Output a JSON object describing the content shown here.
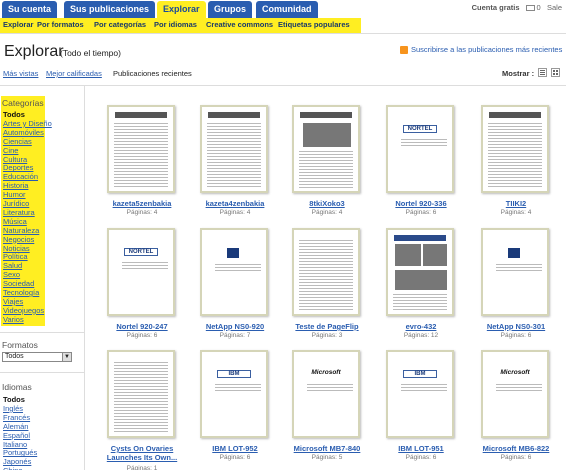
{
  "nav": {
    "tabs": [
      "Su cuenta",
      "Sus publicaciones",
      "Explorar",
      "Grupos",
      "Comunidad"
    ],
    "account": "Cuenta gratis",
    "mail_count": "0",
    "logout": "Sale"
  },
  "subnav": [
    "Explorar",
    "Por formatos",
    "Por categorías",
    "Por idiomas",
    "Creative commons",
    "Etiquetas populares"
  ],
  "header": {
    "title": "Explorar",
    "subtitle": "(Todo el tiempo)",
    "subscribe": "Suscribirse a las publicaciones más recientes"
  },
  "views": {
    "most_viewed": "Más vistas",
    "best_rated": "Mejor calificadas",
    "recent": "Publicaciones recientes",
    "show": "Mostrar :"
  },
  "sidebar": {
    "categories_heading": "Categorías",
    "categories": [
      "Todos",
      "Artes y Diseño",
      "Automóviles",
      "Ciencias",
      "Cine",
      "Cultura",
      "Deportes",
      "Educación",
      "Historia",
      "Humor",
      "Jurídico",
      "Literatura",
      "Música",
      "Naturaleza",
      "Negocios",
      "Noticias",
      "Política",
      "Salud",
      "Sexo",
      "Sociedad",
      "Tecnología",
      "Viajes",
      "Videojuegos",
      "Varios"
    ],
    "formats_heading": "Formatos",
    "format_selected": "Todos",
    "languages_heading": "Idiomas",
    "languages": [
      "Todos",
      "Inglés",
      "Francés",
      "Alemán",
      "Español",
      "Italiano",
      "Portugués",
      "Japonés",
      "Chino"
    ]
  },
  "docs": [
    {
      "title": "kazeta5zenbakia",
      "pages": "Páginas: 4",
      "style": "news"
    },
    {
      "title": "kazeta4zenbakia",
      "pages": "Páginas: 4",
      "style": "news"
    },
    {
      "title": "8tkiXoko3",
      "pages": "Páginas: 4",
      "style": "news2"
    },
    {
      "title": "Nortel 920-336",
      "pages": "Páginas: 6",
      "style": "nortel"
    },
    {
      "title": "TIIKI2",
      "pages": "Páginas: 4",
      "style": "news"
    },
    {
      "title": "Nortel 920-247",
      "pages": "Páginas: 6",
      "style": "nortel"
    },
    {
      "title": "NetApp NS0-920",
      "pages": "Páginas: 7",
      "style": "netapp"
    },
    {
      "title": "Teste de PageFlip",
      "pages": "Páginas: 3",
      "style": "plain"
    },
    {
      "title": "evro-432",
      "pages": "Páginas: 12",
      "style": "magazine"
    },
    {
      "title": "NetApp NS0-301",
      "pages": "Páginas: 6",
      "style": "netapp"
    },
    {
      "title": "Cysts On Ovaries Launches Its Own...",
      "pages": "Páginas: 1",
      "style": "plain"
    },
    {
      "title": "IBM LOT-952",
      "pages": "Páginas: 6",
      "style": "ibm"
    },
    {
      "title": "Microsoft MB7-840",
      "pages": "Páginas: 5",
      "style": "ms"
    },
    {
      "title": "IBM LOT-951",
      "pages": "Páginas: 6",
      "style": "ibm"
    },
    {
      "title": "Microsoft MB6-822",
      "pages": "Páginas: 6",
      "style": "ms"
    }
  ],
  "logos": {
    "nortel": "NORTEL",
    "ibm": "IBM",
    "ms": "Microsoft"
  },
  "colors": {
    "tab_blue": "#2a5db0",
    "highlight_yellow": "#ffee22",
    "link_blue": "#2a5db0",
    "rss_orange": "#f7941d"
  }
}
